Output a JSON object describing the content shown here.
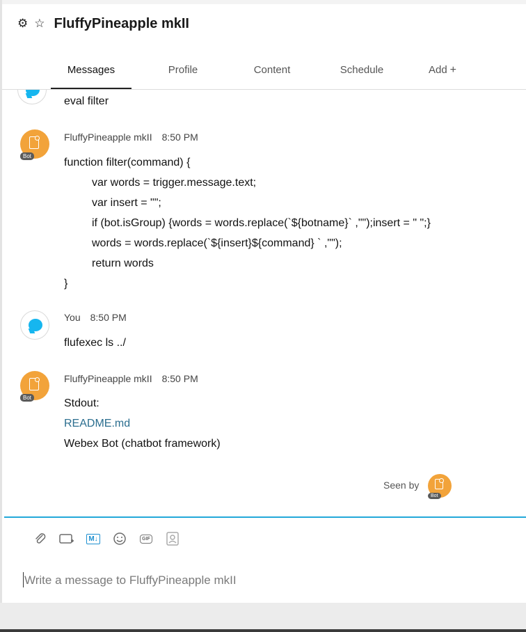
{
  "header": {
    "title": "FluffyPineapple mkII",
    "tabs": [
      {
        "label": "Messages"
      },
      {
        "label": "Profile"
      },
      {
        "label": "Content"
      },
      {
        "label": "Schedule"
      },
      {
        "label": "Add",
        "suffix": "+"
      }
    ]
  },
  "messages": {
    "m0": {
      "line": "eval filter"
    },
    "m1": {
      "sender": "FluffyPineapple mkII",
      "time": "8:50 PM",
      "badge": "Bot",
      "lines": [
        "function filter(command) {",
        "var words = trigger.message.text;",
        "var insert = \"\";",
        "if (bot.isGroup) {words = words.replace(`${botname}` ,\"\");insert = \" \";}",
        "words = words.replace(`${insert}${command} ` ,\"\");",
        "return words",
        "}"
      ]
    },
    "m2": {
      "sender": "You",
      "time": "8:50 PM",
      "line": "flufexec ls ../"
    },
    "m3": {
      "sender": "FluffyPineapple mkII",
      "time": "8:50 PM",
      "badge": "Bot",
      "lines": [
        "Stdout:",
        "README.md",
        "Webex Bot (chatbot framework)"
      ]
    }
  },
  "seen": {
    "label": "Seen by",
    "badge": "Bot"
  },
  "composer": {
    "placeholder": "Write a message to FluffyPineapple mkII"
  },
  "colors": {
    "accent": "#23a8d9",
    "bot_avatar": "#f2a33a",
    "you_bubble": "#16b6ef",
    "link": "#2b6e8f"
  }
}
